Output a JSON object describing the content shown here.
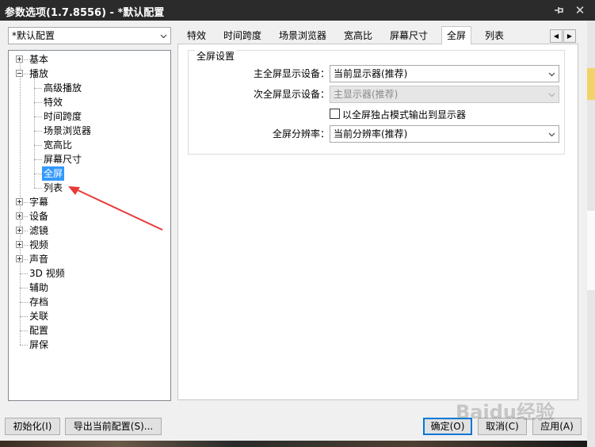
{
  "window": {
    "title": "参数选项(1.7.8556) - *默认配置",
    "pin_icon": "pin-icon",
    "close_icon": "close-icon"
  },
  "profile": {
    "selected": "*默认配置"
  },
  "tree": {
    "items": [
      {
        "label": "基本",
        "level": 0,
        "expander": "plus"
      },
      {
        "label": "播放",
        "level": 0,
        "expander": "minus"
      },
      {
        "label": "高级播放",
        "level": 1
      },
      {
        "label": "特效",
        "level": 1
      },
      {
        "label": "时间跨度",
        "level": 1
      },
      {
        "label": "场景浏览器",
        "level": 1
      },
      {
        "label": "宽高比",
        "level": 1
      },
      {
        "label": "屏幕尺寸",
        "level": 1
      },
      {
        "label": "全屏",
        "level": 1,
        "selected": true
      },
      {
        "label": "列表",
        "level": 1
      },
      {
        "label": "字幕",
        "level": 0,
        "expander": "plus"
      },
      {
        "label": "设备",
        "level": 0,
        "expander": "plus"
      },
      {
        "label": "滤镜",
        "level": 0,
        "expander": "plus"
      },
      {
        "label": "视频",
        "level": 0,
        "expander": "plus"
      },
      {
        "label": "声音",
        "level": 0,
        "expander": "plus"
      },
      {
        "label": "3D 视频",
        "level": 0
      },
      {
        "label": "辅助",
        "level": 0
      },
      {
        "label": "存档",
        "level": 0
      },
      {
        "label": "关联",
        "level": 0
      },
      {
        "label": "配置",
        "level": 0
      },
      {
        "label": "屏保",
        "level": 0
      }
    ]
  },
  "tabs": [
    {
      "label": "特效"
    },
    {
      "label": "时间跨度"
    },
    {
      "label": "场景浏览器"
    },
    {
      "label": "宽高比"
    },
    {
      "label": "屏幕尺寸"
    },
    {
      "label": "全屏",
      "active": true
    },
    {
      "label": "列表"
    }
  ],
  "fullscreen": {
    "group_title": "全屏设置",
    "primary_label": "主全屏显示设备：",
    "primary_value": "当前显示器(推荐)",
    "secondary_label": "次全屏显示设备：",
    "secondary_value": "主显示器(推荐)",
    "secondary_enabled": false,
    "exclusive_label": "以全屏独占模式输出到显示器",
    "exclusive_checked": false,
    "resolution_label": "全屏分辨率：",
    "resolution_value": "当前分辨率(推荐)"
  },
  "buttons": {
    "reset": "初始化(I)",
    "export": "导出当前配置(S)...",
    "ok": "确定(O)",
    "cancel": "取消(C)",
    "apply": "应用(A)"
  },
  "watermark": "Baidu经验",
  "colors": {
    "selection": "#3399ff",
    "arrow": "#e83a3a",
    "titlebar": "#2b2b2b"
  }
}
